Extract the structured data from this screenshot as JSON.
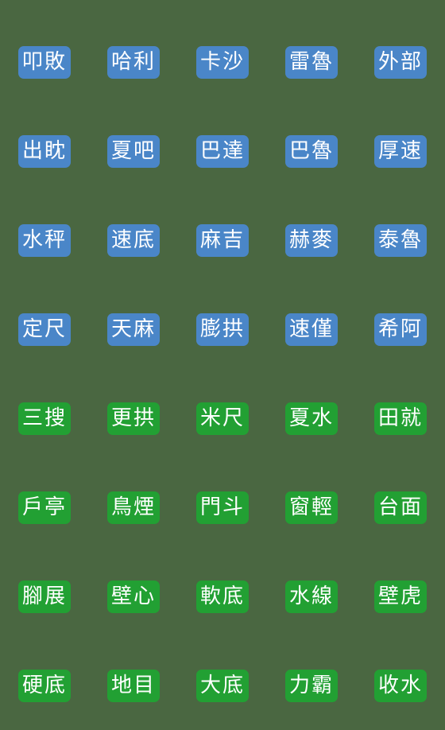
{
  "sheet": {
    "background_color": "#4a6741",
    "columns": 5,
    "rows": 8,
    "blue_color": "#4a86c8",
    "green_color": "#22a033",
    "text_color": "#ffffff"
  },
  "stickers": [
    {
      "label": "叩敗",
      "color": "blue"
    },
    {
      "label": "哈利",
      "color": "blue"
    },
    {
      "label": "卡沙",
      "color": "blue"
    },
    {
      "label": "雷魯",
      "color": "blue"
    },
    {
      "label": "外部",
      "color": "blue"
    },
    {
      "label": "出眈",
      "color": "blue"
    },
    {
      "label": "夏吧",
      "color": "blue"
    },
    {
      "label": "巴達",
      "color": "blue"
    },
    {
      "label": "巴魯",
      "color": "blue"
    },
    {
      "label": "厚速",
      "color": "blue"
    },
    {
      "label": "水秤",
      "color": "blue"
    },
    {
      "label": "速底",
      "color": "blue"
    },
    {
      "label": "麻吉",
      "color": "blue"
    },
    {
      "label": "赫麥",
      "color": "blue"
    },
    {
      "label": "泰魯",
      "color": "blue"
    },
    {
      "label": "定尺",
      "color": "blue"
    },
    {
      "label": "天麻",
      "color": "blue"
    },
    {
      "label": "膨拱",
      "color": "blue"
    },
    {
      "label": "速僅",
      "color": "blue"
    },
    {
      "label": "希阿",
      "color": "blue"
    },
    {
      "label": "三搜",
      "color": "green"
    },
    {
      "label": "更拱",
      "color": "green"
    },
    {
      "label": "米尺",
      "color": "green"
    },
    {
      "label": "夏水",
      "color": "green"
    },
    {
      "label": "田就",
      "color": "green"
    },
    {
      "label": "戶亭",
      "color": "green"
    },
    {
      "label": "鳥煙",
      "color": "green"
    },
    {
      "label": "門斗",
      "color": "green"
    },
    {
      "label": "窗輕",
      "color": "green"
    },
    {
      "label": "台面",
      "color": "green"
    },
    {
      "label": "腳展",
      "color": "green"
    },
    {
      "label": "壁心",
      "color": "green"
    },
    {
      "label": "軟底",
      "color": "green"
    },
    {
      "label": "水線",
      "color": "green"
    },
    {
      "label": "壁虎",
      "color": "green"
    },
    {
      "label": "硬底",
      "color": "green"
    },
    {
      "label": "地目",
      "color": "green"
    },
    {
      "label": "大底",
      "color": "green"
    },
    {
      "label": "力霸",
      "color": "green"
    },
    {
      "label": "收水",
      "color": "green"
    }
  ]
}
